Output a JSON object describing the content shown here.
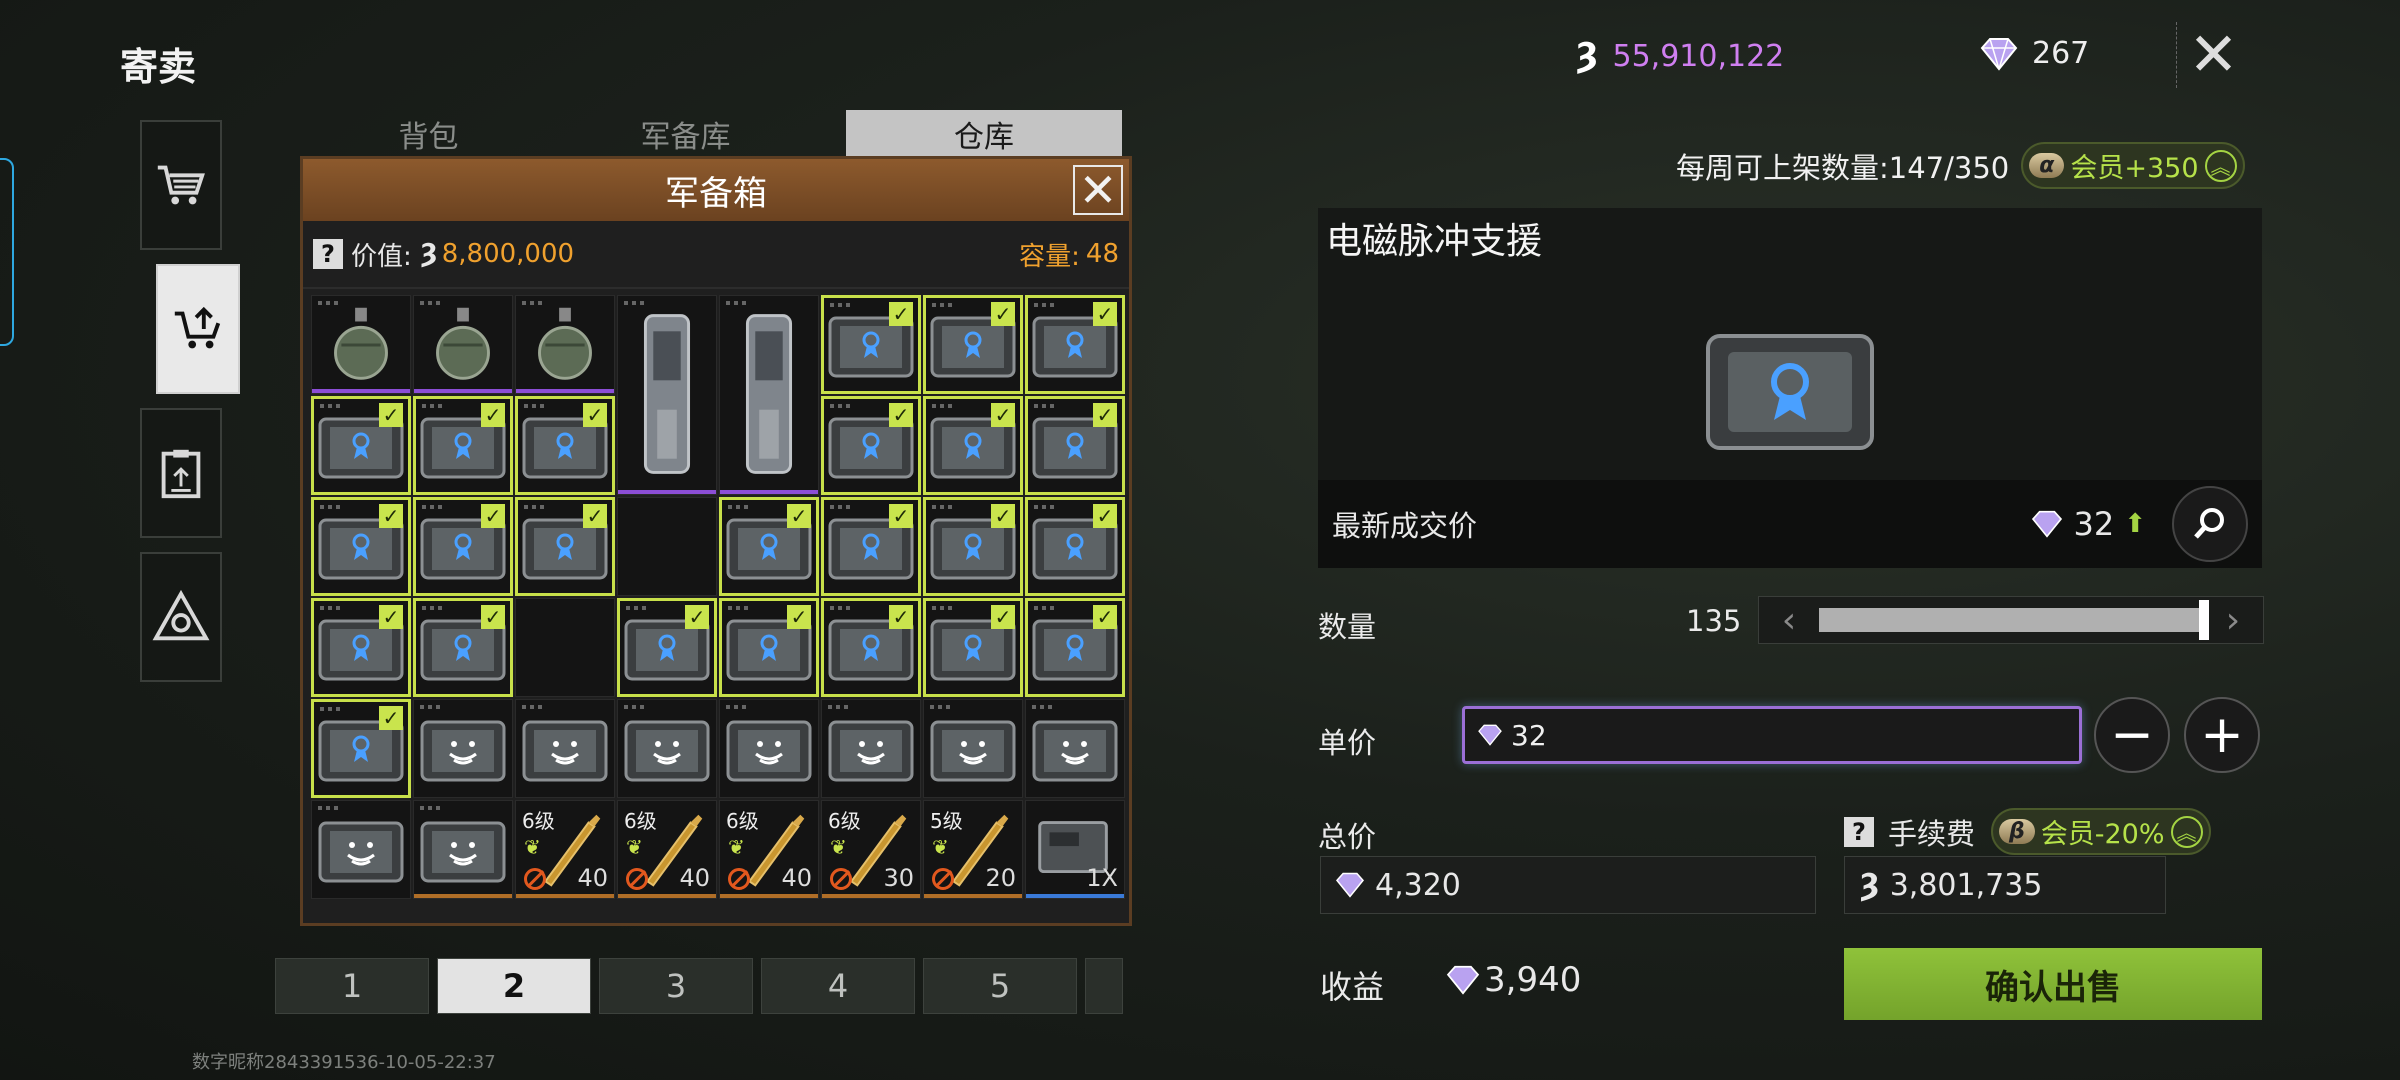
{
  "page_title": "寄卖",
  "currency": {
    "coins": "55,910,122",
    "gems": "267"
  },
  "tabs": [
    {
      "label": "背包"
    },
    {
      "label": "军备库"
    },
    {
      "label": "仓库"
    }
  ],
  "modal": {
    "title": "军备箱",
    "value_label": "价值:",
    "value": "8,800,000",
    "capacity_label": "容量:",
    "capacity": "48",
    "cells": [
      {
        "type": "grenade",
        "selected": false,
        "bar": "purple"
      },
      {
        "type": "grenade",
        "selected": false,
        "bar": "purple"
      },
      {
        "type": "grenade",
        "selected": false,
        "bar": "purple"
      },
      {
        "type": "canister",
        "selected": false,
        "bar": "purple",
        "span": true
      },
      {
        "type": "canister",
        "selected": false,
        "bar": "purple",
        "span": true
      },
      {
        "type": "tablet",
        "selected": true
      },
      {
        "type": "tablet",
        "selected": true
      },
      {
        "type": "tablet",
        "selected": true
      },
      {
        "type": "tablet",
        "selected": true
      },
      {
        "type": "tablet",
        "selected": true
      },
      {
        "type": "tablet",
        "selected": true
      },
      {
        "type": "tablet",
        "selected": true
      },
      {
        "type": "tablet",
        "selected": true
      },
      {
        "type": "tablet",
        "selected": true
      },
      {
        "type": "tablet",
        "selected": true
      },
      {
        "type": "tablet",
        "selected": true
      },
      {
        "type": "tablet",
        "selected": true
      },
      {
        "type": "empty"
      },
      {
        "type": "tablet",
        "selected": true
      },
      {
        "type": "tablet",
        "selected": true
      },
      {
        "type": "tablet",
        "selected": true
      },
      {
        "type": "tablet",
        "selected": true
      },
      {
        "type": "tablet",
        "selected": true
      },
      {
        "type": "tablet",
        "selected": true
      },
      {
        "type": "empty"
      },
      {
        "type": "tablet",
        "selected": true
      },
      {
        "type": "tablet",
        "selected": true
      },
      {
        "type": "tablet",
        "selected": true
      },
      {
        "type": "tablet",
        "selected": true
      },
      {
        "type": "tablet",
        "selected": true
      },
      {
        "type": "tablet",
        "selected": true
      },
      {
        "type": "smile",
        "selected": false
      },
      {
        "type": "smile",
        "selected": false
      },
      {
        "type": "smile",
        "selected": false
      },
      {
        "type": "smile",
        "selected": false
      },
      {
        "type": "smile",
        "selected": false
      },
      {
        "type": "smile",
        "selected": false
      },
      {
        "type": "smile",
        "selected": false
      },
      {
        "type": "smile",
        "selected": false
      },
      {
        "type": "smile",
        "selected": false,
        "bar": "orange"
      },
      {
        "type": "ammo",
        "level": "6级",
        "qty": "40",
        "bar": "orange"
      },
      {
        "type": "ammo",
        "level": "6级",
        "qty": "40",
        "bar": "orange"
      },
      {
        "type": "ammo",
        "level": "6级",
        "qty": "40",
        "bar": "orange"
      },
      {
        "type": "ammo",
        "level": "6级",
        "qty": "30",
        "bar": "orange"
      },
      {
        "type": "ammo",
        "level": "5级",
        "qty": "20",
        "bar": "orange"
      },
      {
        "type": "box",
        "qty": "1X",
        "bar": "blue"
      }
    ]
  },
  "pages": [
    "1",
    "2",
    "3",
    "4",
    "5"
  ],
  "active_page": "2",
  "watermark": "数字昵称2843391536-10-05-22:37",
  "weekly": {
    "label": "每周可上架数量:147/350",
    "vip": "会员+350"
  },
  "item": {
    "name": "电磁脉冲支援",
    "last_price_label": "最新成交价",
    "last_price": "32"
  },
  "quantity": {
    "label": "数量",
    "value": "135",
    "fill": 1.0
  },
  "unit_price": {
    "label": "单价",
    "value": "32"
  },
  "total": {
    "label": "总价",
    "value": "4,320"
  },
  "fee": {
    "label": "手续费",
    "vip": "会员-20%",
    "value": "3,801,735"
  },
  "income": {
    "label": "收益",
    "value": "3,940"
  },
  "confirm_label": "确认出售",
  "colors": {
    "accent_green": "#8fc23a",
    "coin_purple": "#cf7ff0",
    "orange": "#f0a12e",
    "select_green": "#c8e04a"
  }
}
